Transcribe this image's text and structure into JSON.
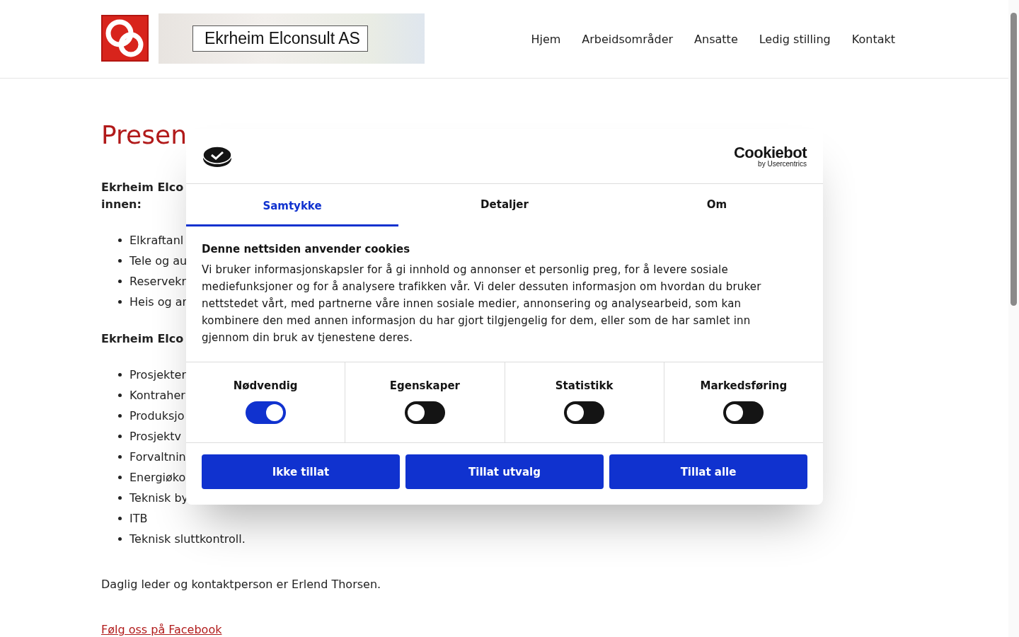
{
  "header": {
    "banner_text": "Ekrheim Elconsult AS",
    "nav": [
      {
        "label": "Hjem"
      },
      {
        "label": "Arbeidsområder"
      },
      {
        "label": "Ansatte"
      },
      {
        "label": "Ledig stilling"
      },
      {
        "label": "Kontakt"
      }
    ]
  },
  "content": {
    "title": "Presen",
    "intro": [
      "Ekrheim Elco",
      "innen:"
    ],
    "list_1": [
      "Elkraftanl",
      "Tele og au",
      "Reservekr",
      "Heis og ar"
    ],
    "heading_2": "Ekrheim Elco",
    "list_2": [
      "Prosjekter",
      "Kontraher",
      "Produksjo",
      "Prosjektv",
      "Forvaltnin",
      "Energiøko",
      "Teknisk by",
      "ITB",
      "Teknisk sluttkontroll."
    ],
    "contact": "Daglig leder og kontaktperson er Erlend Thorsen.",
    "facebook_link": "Følg oss på Facebook"
  },
  "cookie_dialog": {
    "brand": "Cookiebot",
    "brand_sub": "by Usercentrics",
    "tabs": [
      {
        "label": "Samtykke",
        "selected": true
      },
      {
        "label": "Detaljer",
        "selected": false
      },
      {
        "label": "Om",
        "selected": false
      }
    ],
    "heading": "Denne nettsiden anvender cookies",
    "body": "Vi bruker informasjonskapsler for å gi innhold og annonser et personlig preg, for å levere sosiale mediefunksjoner og for å analysere trafikken vår. Vi deler dessuten informasjon om hvordan du bruker nettstedet vårt, med partnerne våre innen sosiale medier, annonsering og analysearbeid, som kan kombinere den med annen informasjon du har gjort tilgjengelig for dem, eller som de har samlet inn gjennom din bruk av tjenestene deres.",
    "categories": [
      {
        "label": "Nødvendig",
        "checked": true
      },
      {
        "label": "Egenskaper",
        "checked": false
      },
      {
        "label": "Statistikk",
        "checked": false
      },
      {
        "label": "Markedsføring",
        "checked": false
      }
    ],
    "buttons": [
      "Ikke tillat",
      "Tillat utvalg",
      "Tillat alle"
    ]
  }
}
